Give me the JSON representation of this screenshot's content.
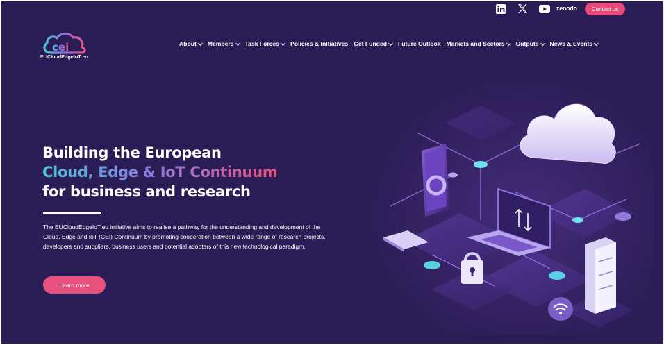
{
  "topbar": {
    "social": [
      {
        "name": "linkedin-icon"
      },
      {
        "name": "x-icon"
      },
      {
        "name": "youtube-icon"
      }
    ],
    "zenodo_label": "zenodo",
    "contact_label": "Contact us"
  },
  "logo": {
    "mark": "cei",
    "text_prefix": "EU",
    "text_bold": "CloudEdgeIoT",
    "text_suffix": ".eu"
  },
  "nav": {
    "items": [
      {
        "label": "About",
        "dropdown": true
      },
      {
        "label": "Members",
        "dropdown": true
      },
      {
        "label": "Task Forces",
        "dropdown": true
      },
      {
        "label": "Policies & Initiatives",
        "dropdown": false
      },
      {
        "label": "Get Funded",
        "dropdown": true
      },
      {
        "label": "Future Outlook",
        "dropdown": false
      },
      {
        "label": "Markets and Sectors",
        "dropdown": true
      },
      {
        "label": "Outputs",
        "dropdown": true
      },
      {
        "label": "News & Events",
        "dropdown": true
      }
    ]
  },
  "hero": {
    "title_line1": "Building the European",
    "title_line2": "Cloud, Edge & IoT Continuum",
    "title_line3": "for business and research",
    "description": "The EUCloudEdgeIoT.eu initiative aims to realise a pathway for the understanding and development of the Cloud, Edge and IoT (CEI) Continuum by promoting cooperation between a wide range of research projects, developers and suppliers, business users and potential adopters of this new technological paradigm.",
    "cta_label": "Learn more"
  },
  "colors": {
    "background": "#2a1d55",
    "accent_pink": "#e8507e",
    "accent_teal": "#4bc3d6"
  }
}
